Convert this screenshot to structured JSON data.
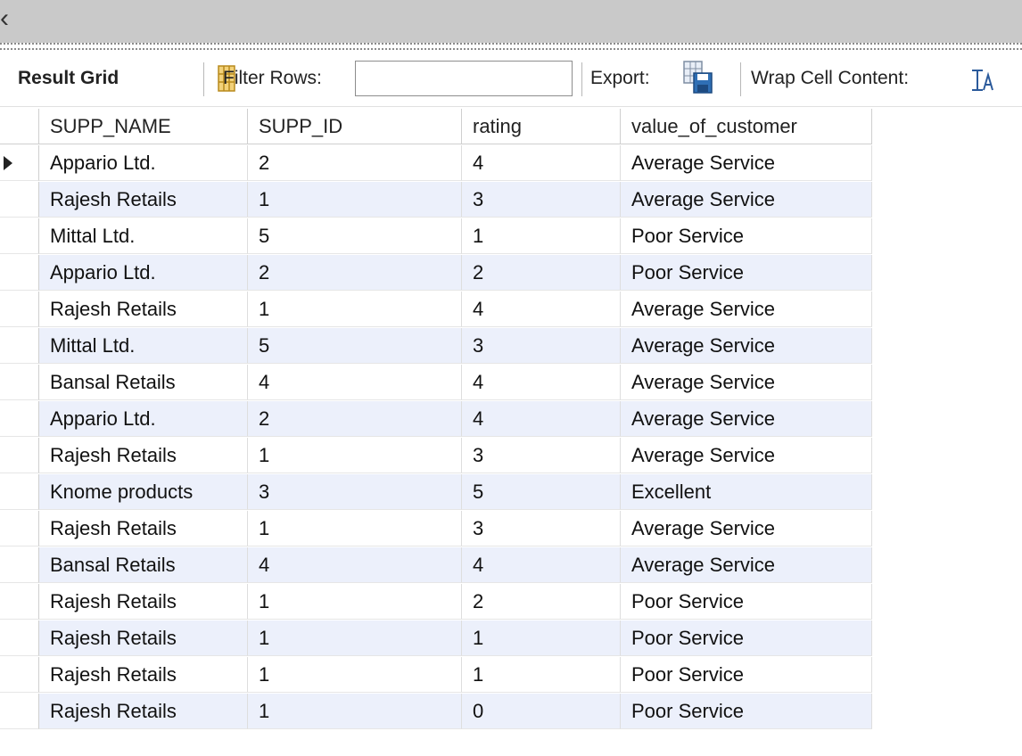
{
  "window": {
    "collapse_glyph": "‹"
  },
  "toolbar": {
    "result_grid_label": "Result Grid",
    "grid_icon": "grid-view-icon",
    "filter_label": "Filter Rows:",
    "filter_value": "",
    "export_label": "Export:",
    "export_icon": "export-icon",
    "wrap_label": "Wrap Cell Content:",
    "wrap_icon": "wrap-cell-icon"
  },
  "table": {
    "columns": [
      "SUPP_NAME",
      "SUPP_ID",
      "rating",
      "value_of_customer"
    ],
    "selected_row": 0,
    "rows": [
      [
        "Appario Ltd.",
        "2",
        "4",
        "Average Service"
      ],
      [
        "Rajesh Retails",
        "1",
        "3",
        "Average Service"
      ],
      [
        "Mittal Ltd.",
        "5",
        "1",
        "Poor Service"
      ],
      [
        "Appario Ltd.",
        "2",
        "2",
        "Poor Service"
      ],
      [
        "Rajesh Retails",
        "1",
        "4",
        "Average Service"
      ],
      [
        "Mittal Ltd.",
        "5",
        "3",
        "Average Service"
      ],
      [
        "Bansal Retails",
        "4",
        "4",
        "Average Service"
      ],
      [
        "Appario Ltd.",
        "2",
        "4",
        "Average Service"
      ],
      [
        "Rajesh Retails",
        "1",
        "3",
        "Average Service"
      ],
      [
        "Knome products",
        "3",
        "5",
        "Excellent"
      ],
      [
        "Rajesh Retails",
        "1",
        "3",
        "Average Service"
      ],
      [
        "Bansal Retails",
        "4",
        "4",
        "Average Service"
      ],
      [
        "Rajesh Retails",
        "1",
        "2",
        "Poor Service"
      ],
      [
        "Rajesh Retails",
        "1",
        "1",
        "Poor Service"
      ],
      [
        "Rajesh Retails",
        "1",
        "1",
        "Poor Service"
      ],
      [
        "Rajesh Retails",
        "1",
        "0",
        "Poor Service"
      ]
    ]
  },
  "colors": {
    "alt_row": "#ecf0fb",
    "topbar": "#c9c9c9"
  }
}
